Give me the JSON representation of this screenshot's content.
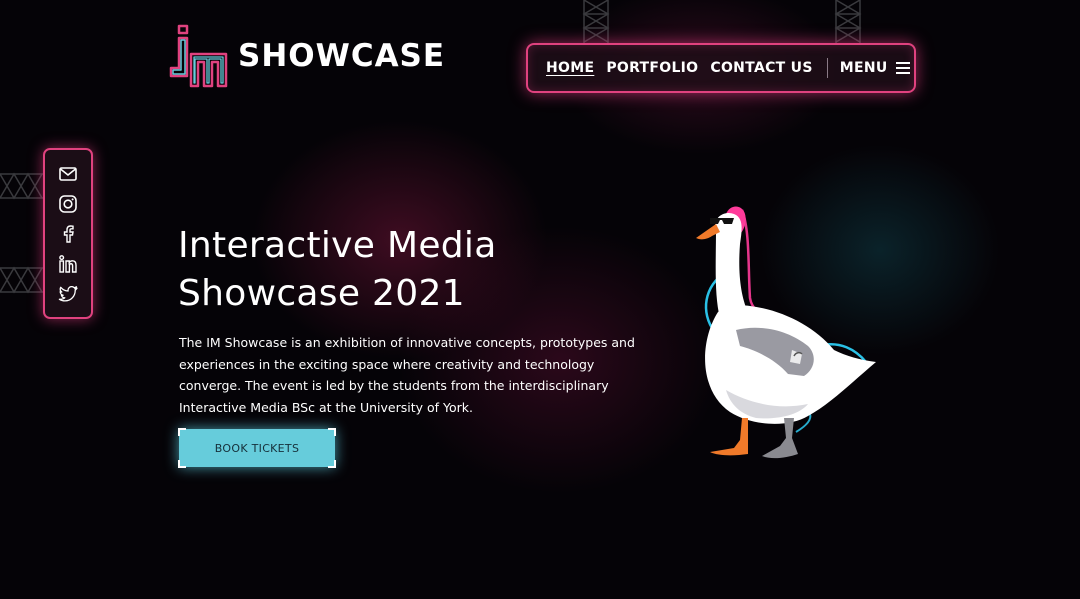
{
  "brand": {
    "logo_text": "SHOWCASE",
    "logo_mark": "IM"
  },
  "nav": {
    "links": [
      {
        "label": "HOME",
        "active": true
      },
      {
        "label": "PORTFOLIO",
        "active": false
      },
      {
        "label": "CONTACT US",
        "active": false
      }
    ],
    "menu_label": "MENU",
    "menu_icon": "hamburger-icon"
  },
  "social": {
    "icons": [
      "mail-icon",
      "instagram-icon",
      "facebook-icon",
      "linkedin-icon",
      "twitter-icon"
    ]
  },
  "hero": {
    "title_line1": "Interactive Media",
    "title_line2": "Showcase 2021",
    "description": "The IM Showcase is an exhibition of innovative concepts, prototypes and experiences in the exciting space where creativity and technology converge. The event is led by the students from the interdisciplinary Interactive Media BSc at the University of York.",
    "cta_label": "BOOK TICKETS"
  },
  "colors": {
    "background": "#050307",
    "neon_pink": "#e0427f",
    "neon_cyan": "#66ccdb",
    "text": "#ffffff"
  }
}
